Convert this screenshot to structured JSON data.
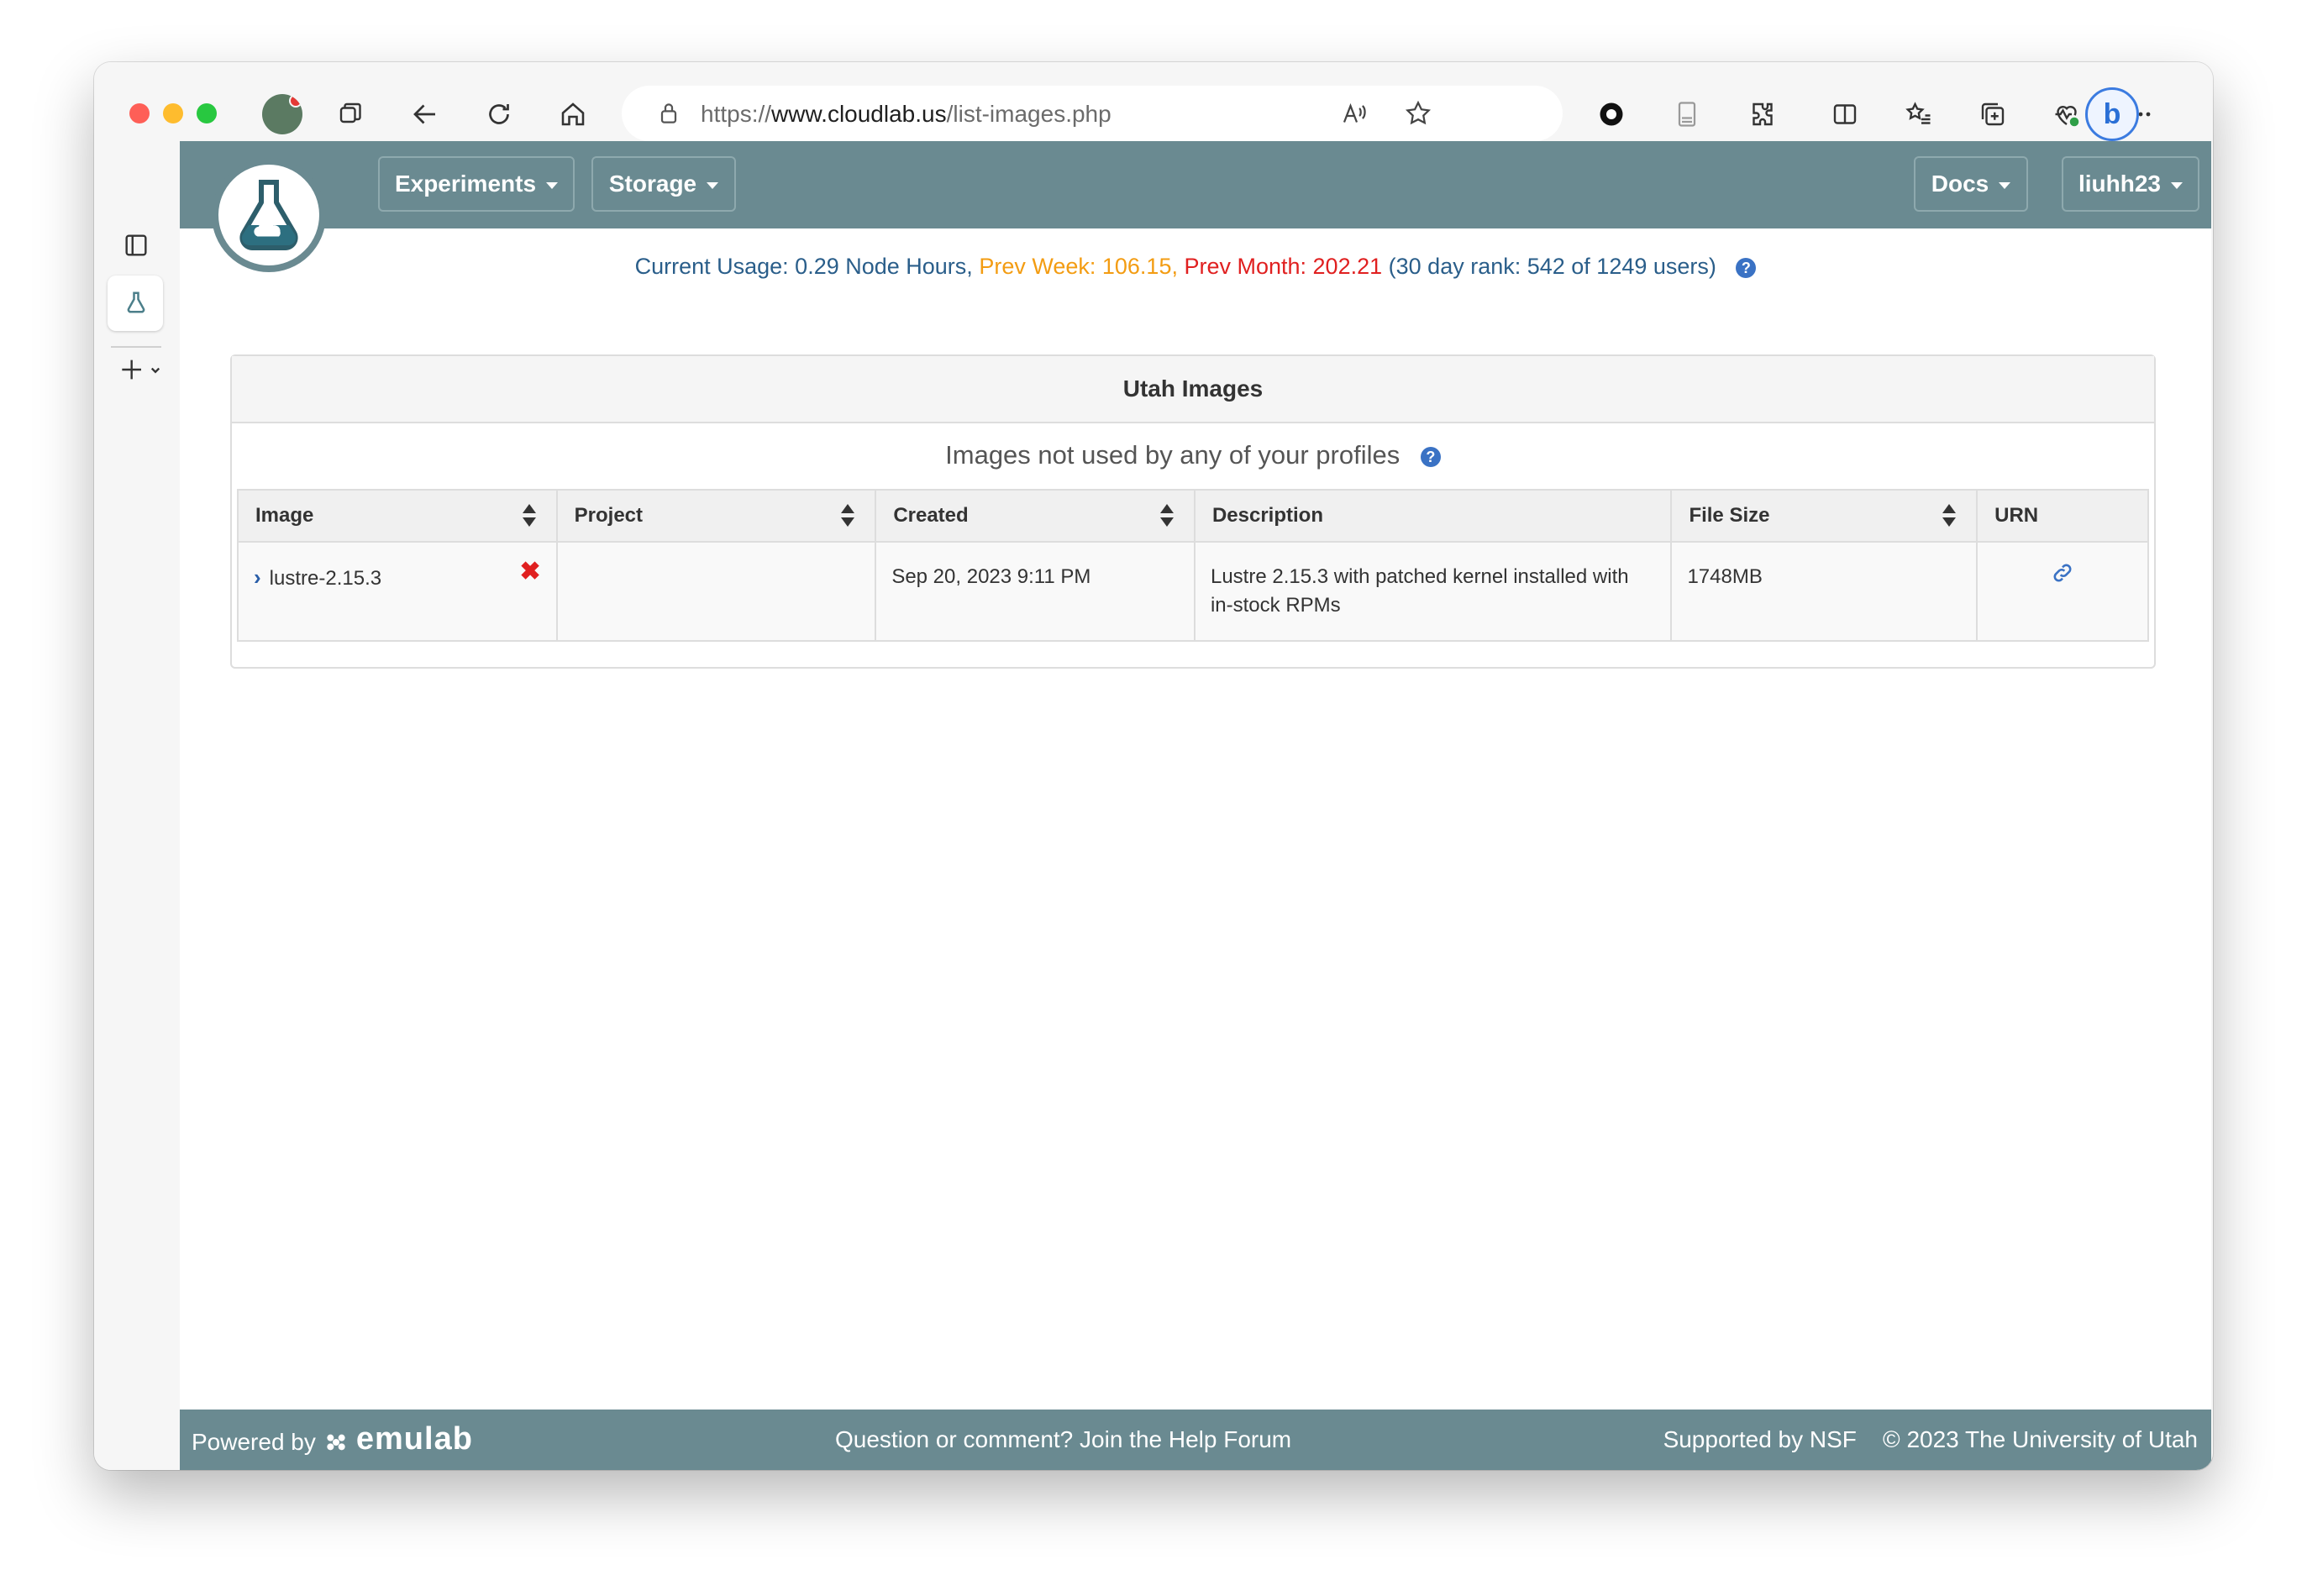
{
  "browser": {
    "url_scheme": "https://",
    "url_host": "www.cloudlab.us",
    "url_path": "/list-images.php"
  },
  "nav": {
    "experiments_label": "Experiments",
    "storage_label": "Storage",
    "docs_label": "Docs",
    "user_label": "liuhh23"
  },
  "usage": {
    "current": "Current Usage: 0.29 Node Hours,",
    "prev_week": "Prev Week: 106.15,",
    "prev_month": "Prev Month: 202.21",
    "rank": "(30 day rank: 542 of 1249 users)",
    "help_glyph": "?"
  },
  "panel": {
    "title": "Utah Images",
    "subtitle": "Images not used by any of your profiles",
    "help_glyph": "?"
  },
  "table": {
    "headers": [
      "Image",
      "Project",
      "Created",
      "Description",
      "File Size",
      "URN"
    ],
    "rows": [
      {
        "image": "lustre-2.15.3",
        "project": "",
        "created": "Sep 20, 2023 9:11 PM",
        "description": "Lustre 2.15.3 with patched kernel installed with in-stock RPMs",
        "file_size": "1748MB"
      }
    ]
  },
  "footer": {
    "powered_by": "Powered by",
    "brand": "emulab",
    "help": "Question or comment? Join the Help Forum",
    "nsf": "Supported by NSF",
    "copyright": "© 2023 The University of Utah"
  },
  "colors": {
    "navbar": "#6a8a91",
    "usage_blue": "#2a5e8a",
    "usage_orange": "#f39c12",
    "usage_red": "#e02020",
    "link_blue": "#3a72c4"
  },
  "icons": [
    "profile-avatar",
    "workspaces-icon",
    "back-icon",
    "refresh-icon",
    "home-icon",
    "lock-icon",
    "read-aloud-icon",
    "favorite-icon",
    "extension-record-icon",
    "page-icon",
    "extensions-icon",
    "split-screen-icon",
    "favorites-icon",
    "collections-icon",
    "health-icon",
    "more-icon",
    "bing-chat-icon",
    "tab-actions-icon",
    "cloudlab-tab-icon",
    "new-tab-icon",
    "cloudlab-logo-icon",
    "sort-icon",
    "expand-chevron-icon",
    "delete-icon",
    "link-icon",
    "help-icon"
  ]
}
